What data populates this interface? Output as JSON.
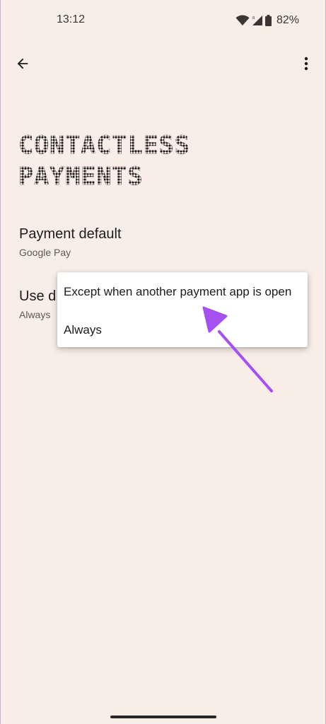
{
  "status_bar": {
    "time": "13:12",
    "battery": "82%"
  },
  "app_bar": {
    "back_icon": "arrow-back-icon",
    "more_icon": "more-vert-icon"
  },
  "page": {
    "title": "CONTACTLESS\nPAYMENTS"
  },
  "preferences": {
    "payment_default": {
      "title": "Payment default",
      "summary": "Google Pay"
    },
    "use_default": {
      "title": "Use d",
      "summary": "Always"
    }
  },
  "popup": {
    "options": [
      {
        "label": "Except when another payment app is open"
      },
      {
        "label": "Always"
      }
    ]
  },
  "colors": {
    "background": "#f8ede7",
    "annotation_arrow": "#a550f0",
    "text": "#1d1b1a"
  }
}
